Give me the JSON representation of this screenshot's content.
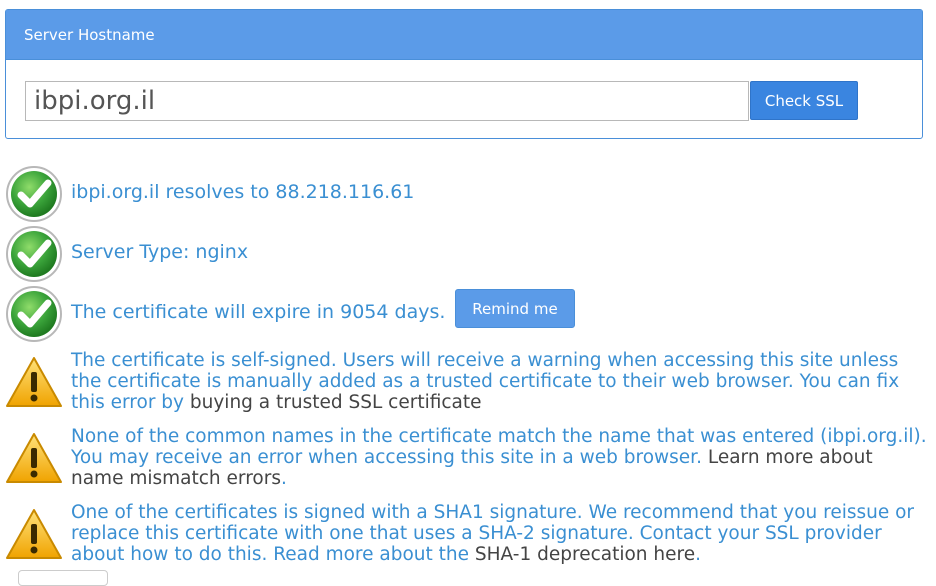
{
  "panel": {
    "title": "Server Hostname",
    "hostname_value": "ibpi.org.il",
    "check_button": "Check SSL"
  },
  "results": [
    {
      "status": "ok",
      "text": "ibpi.org.il resolves to 88.218.116.61"
    },
    {
      "status": "ok",
      "text": "Server Type: nginx"
    },
    {
      "status": "ok",
      "text": "The certificate will expire in 9054 days.",
      "button": "Remind me"
    },
    {
      "status": "warning",
      "text": "The certificate is self-signed. Users will receive a warning when accessing this site unless the certificate is manually added as a trusted certificate to their web browser. You can fix this error by ",
      "link": "buying a trusted SSL certificate"
    },
    {
      "status": "warning",
      "text": "None of the common names in the certificate match the name that was entered (ibpi.org.il). You may receive an error when accessing this site in a web browser. ",
      "link": "Learn more about name mismatch errors",
      "suffix": "."
    },
    {
      "status": "warning",
      "text": "One of the certificates is signed with a SHA1 signature. We recommend that you reissue or replace this certificate with one that uses a SHA-2 signature. Contact your SSL provider about how to do this. Read more about the ",
      "link": "SHA-1 deprecation here",
      "suffix": "."
    }
  ],
  "colors": {
    "accent": "#3a85e0",
    "header": "#5b9be8",
    "text_link": "#3a8fd2",
    "ok_green": "#3aa33a",
    "warn_yellow": "#f2b81e"
  }
}
